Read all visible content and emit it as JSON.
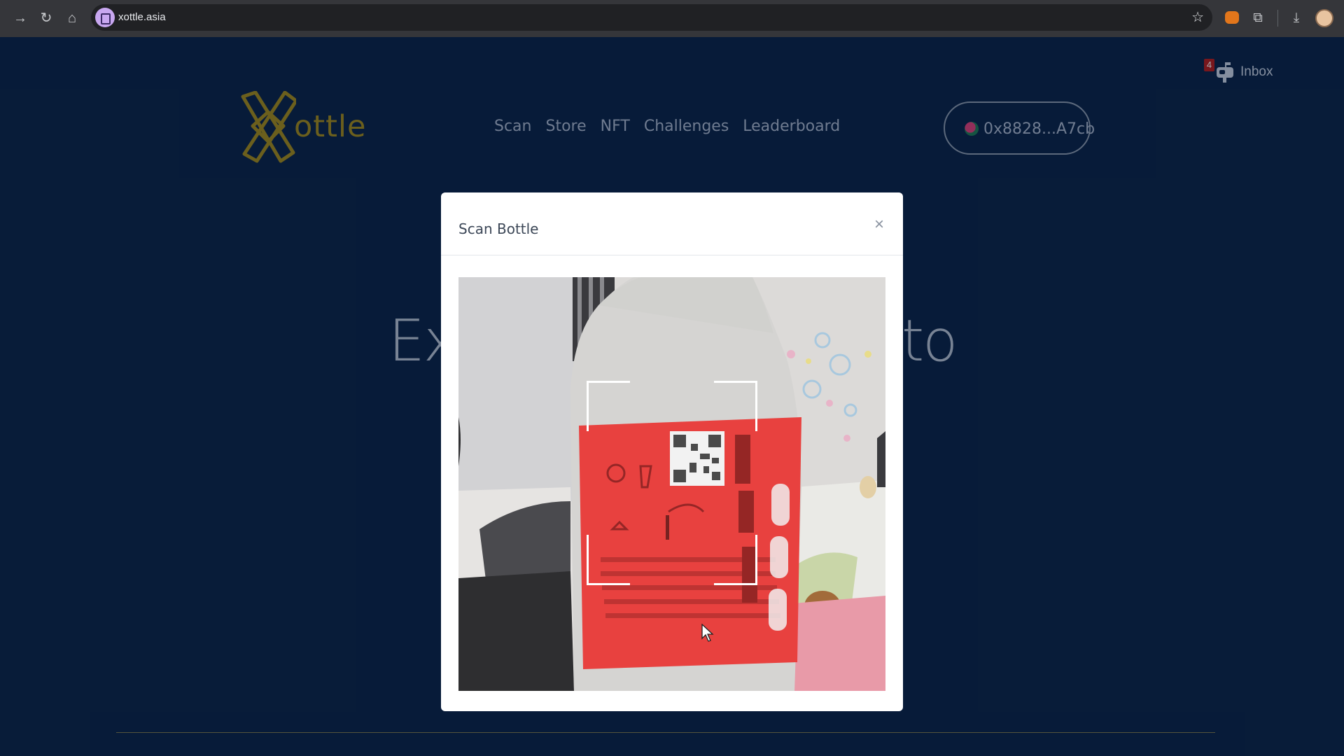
{
  "browser": {
    "url": "xottle.asia",
    "icons": [
      "back-icon",
      "reload-icon",
      "home-icon",
      "bookmark-star-icon",
      "metamask-extension-icon",
      "extensions-icon",
      "download-icon",
      "profile-avatar"
    ]
  },
  "header": {
    "inbox": {
      "badge_count": "4",
      "label": "Inbox"
    },
    "logo_text": "ottle",
    "nav": [
      "Scan",
      "Store",
      "NFT",
      "Challenges",
      "Leaderboard"
    ],
    "wallet_label": "0x8828...A7cb"
  },
  "hero": {
    "left_fragment": "Ex",
    "right_fragment": "to"
  },
  "modal": {
    "title": "Scan Bottle",
    "close_symbol": "×"
  },
  "colors": {
    "page_background": "#0a2347",
    "logo_gold": "#a48a1c",
    "nav_text": "#a9b6cc",
    "badge_red": "#b71c1c",
    "bottle_label_red": "#e8413f"
  }
}
